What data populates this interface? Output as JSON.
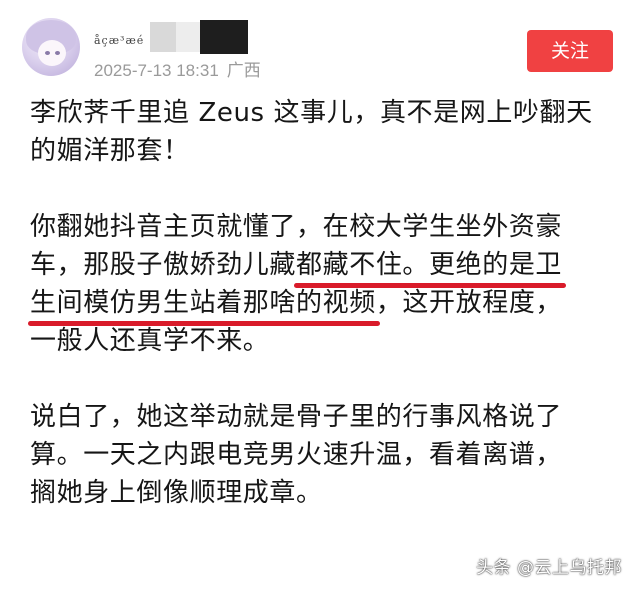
{
  "author": {
    "username": "åçæ³æé",
    "timestamp": "2025-7-13 18:31",
    "location": "广西"
  },
  "follow_button": {
    "label": "关注"
  },
  "post": {
    "para1": {
      "line1": "李欣荠千里追 Zeus 这事儿，真不是网上吵翻天",
      "line2": "的媚洋那套！"
    },
    "para2": {
      "line1": "你翻她抖音主页就懂了，在校大学生坐外资豪",
      "line2_pre": "车，那股子傲娇劲儿藏",
      "line2_hl": "都藏不住。更绝的是卫",
      "line3_hl": "生间模仿男生站着那啥的视频",
      "line3_post": "，这开放程度，",
      "line4": "一般人还真学不来。"
    },
    "para3": {
      "line1": "说白了，她这举动就是骨子里的行事风格说了",
      "line2": "算。一天之内跟电竞男火速升温，看着离谱，",
      "line3": "搁她身上倒像顺理成章。"
    }
  },
  "watermark": "头条 @云上乌托邦",
  "colors": {
    "follow_button": "#f04142",
    "underline": "#d91b2a",
    "meta_text": "#9a9a9a"
  }
}
